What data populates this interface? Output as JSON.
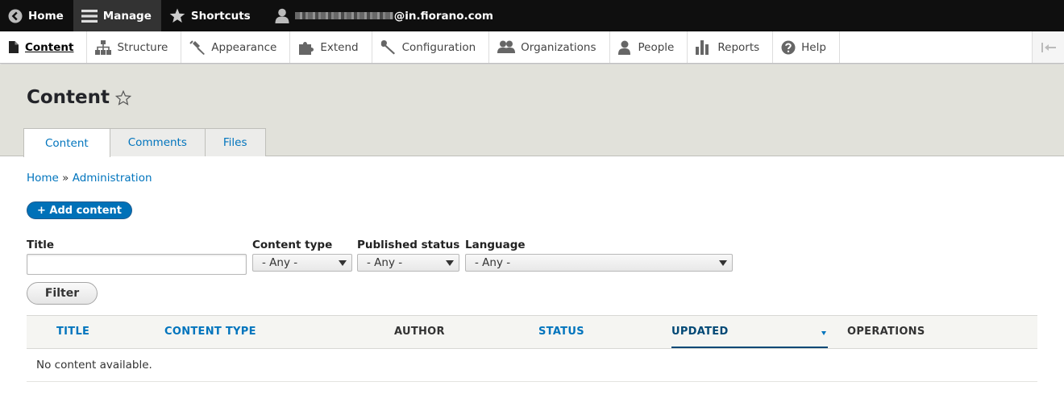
{
  "toolbar": {
    "home_label": "Home",
    "manage_label": "Manage",
    "shortcuts_label": "Shortcuts",
    "user_domain": "@in.fiorano.com"
  },
  "tray": {
    "items": [
      {
        "label": "Content",
        "icon": "file-icon"
      },
      {
        "label": "Structure",
        "icon": "sitemap-icon"
      },
      {
        "label": "Appearance",
        "icon": "brush-icon"
      },
      {
        "label": "Extend",
        "icon": "puzzle-icon"
      },
      {
        "label": "Configuration",
        "icon": "wrench-icon"
      },
      {
        "label": "Organizations",
        "icon": "group-icon"
      },
      {
        "label": "People",
        "icon": "person-icon"
      },
      {
        "label": "Reports",
        "icon": "bar-chart-icon"
      },
      {
        "label": "Help",
        "icon": "help-icon"
      }
    ]
  },
  "page": {
    "title": "Content",
    "tabs": [
      "Content",
      "Comments",
      "Files"
    ]
  },
  "breadcrumb": {
    "home": "Home",
    "separator": " » ",
    "admin": "Administration"
  },
  "actions": {
    "add_content": "+ Add content"
  },
  "filters": {
    "title_label": "Title",
    "title_value": "",
    "content_type_label": "Content type",
    "content_type_value": "- Any -",
    "published_label": "Published status",
    "published_value": "- Any -",
    "language_label": "Language",
    "language_value": "- Any -",
    "filter_button": "Filter"
  },
  "table": {
    "headers": [
      "TITLE",
      "CONTENT TYPE",
      "AUTHOR",
      "STATUS",
      "UPDATED",
      "OPERATIONS"
    ],
    "empty_message": "No content available."
  },
  "colors": {
    "link": "#0074bd",
    "primary_button": "#0071b8",
    "toolbar": "#0f0f0f",
    "header_bg": "#e1e1da"
  }
}
